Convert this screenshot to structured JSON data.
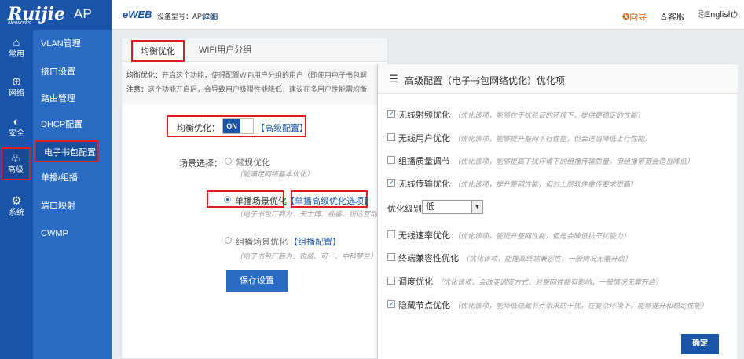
{
  "brand": {
    "name": "Ruijie",
    "sub": "Networks",
    "product": "AP"
  },
  "rail": [
    {
      "icon": "⌂",
      "label": "常用"
    },
    {
      "icon": "⊕",
      "label": "网络"
    },
    {
      "icon": "◐",
      "label": "安全"
    },
    {
      "icon": "♧",
      "label": "高级"
    },
    {
      "icon": "⚙",
      "label": "系统"
    }
  ],
  "menu": [
    "VLAN管理",
    "接口设置",
    "路由管理",
    "DHCP配置",
    "电子书包配置",
    "单播/组播",
    "端口映射",
    "CWMP"
  ],
  "topbar": {
    "eweb": "eWEB",
    "model": "设备型号：AP320-I",
    "detail": "详细",
    "guide": "向导",
    "service": "客服",
    "language": "English"
  },
  "tabs": [
    "均衡优化",
    "WIFI用户分组"
  ],
  "notes": {
    "line1_label": "均衡优化：",
    "line1_text": "开启这个功能，使得配置WiFi用户分组的用户（即使用电子书包解",
    "line2_label": "注意：",
    "line2_text": "这个功能开启后，会导致用户极限性能降低，建议在多用户性能需均衡"
  },
  "balance": {
    "label": "均衡优化：",
    "toggle": "ON",
    "advanced_link": "【高级配置】"
  },
  "scene": {
    "label": "场景选择：",
    "options": [
      {
        "name": "常规优化",
        "desc": "（能满足网络基本优化）"
      },
      {
        "name": "单播场景优化",
        "link": "【单播高级优化选项】",
        "desc": "（电子书包厂商为：天士博、视睿、锐达互动、"
      },
      {
        "name": "组播场景优化",
        "link": "【组播配置】",
        "desc": "（电子书包厂商为：锐威、可一、中科梦兰）"
      }
    ]
  },
  "save_label": "保存设置",
  "dialog": {
    "title": "高级配置（电子书包网络优化）优化项",
    "options": [
      {
        "checked": true,
        "name": "无线射频优化",
        "desc": "（优化该项，能够在干扰验证的环境下，提供更稳定的性能）"
      },
      {
        "checked": false,
        "name": "无线用户优化",
        "desc": "（优化该项，能够提升整网下行性能，但会适当降低上行性能）"
      },
      {
        "checked": false,
        "name": "组播质量调节",
        "desc": "（优化该项，能够提高干扰环境下的组播传输质量，但组播带宽会适当降低）"
      },
      {
        "checked": true,
        "name": "无线传输优化",
        "desc": "（优化该项，提升整网性能，但对上层软件重传要求提高）"
      }
    ],
    "level_label": "优化级别：",
    "level_value": "低",
    "options2": [
      {
        "checked": false,
        "name": "无线速率优化",
        "desc": "（优化该项，能提升整网性能，但是会降低抗干扰能力）"
      },
      {
        "checked": false,
        "name": "终端兼容性优化",
        "desc": "（优化该项，能提高终端兼容性，一般情况无需开启）"
      },
      {
        "checked": false,
        "name": "调度优化",
        "desc": "（优化该项，会改变调度方式，对整网性能有影响，一般情况无需开启）"
      },
      {
        "checked": true,
        "name": "隐藏节点优化",
        "desc": "（优化该项，能降低隐藏节点带来的干扰，在复杂环境下，能够提升和稳定性能）"
      }
    ],
    "ok_label": "确定"
  },
  "colors": {
    "accent": "#1a54a8",
    "rail": "#1a54a8",
    "menu": "#2a6bc4",
    "highlight": "#e02020"
  }
}
